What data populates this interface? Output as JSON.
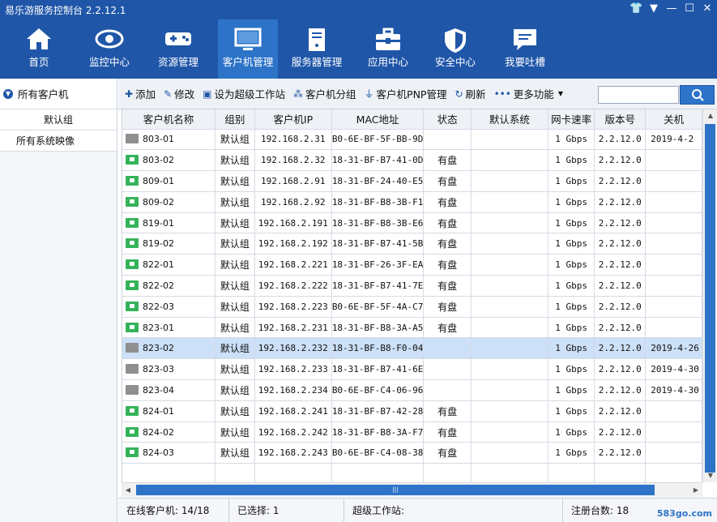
{
  "app": {
    "title": "易乐游服务控制台 2.2.12.1"
  },
  "nav": [
    {
      "id": "home",
      "label": "首页",
      "icon": "home-icon"
    },
    {
      "id": "monitor",
      "label": "监控中心",
      "icon": "eye-icon"
    },
    {
      "id": "resource",
      "label": "资源管理",
      "icon": "gamepad-icon"
    },
    {
      "id": "client",
      "label": "客户机管理",
      "icon": "monitor-icon",
      "active": true
    },
    {
      "id": "server",
      "label": "服务器管理",
      "icon": "server-icon"
    },
    {
      "id": "apps",
      "label": "应用中心",
      "icon": "toolbox-icon"
    },
    {
      "id": "security",
      "label": "安全中心",
      "icon": "shield-icon"
    },
    {
      "id": "feedback",
      "label": "我要吐槽",
      "icon": "message-icon"
    }
  ],
  "left_panel": {
    "header": "所有客户机",
    "items": [
      "默认组",
      "所有系统映像"
    ]
  },
  "toolbar": {
    "add": "添加",
    "edit": "修改",
    "super_ws": "设为超级工作站",
    "group": "客户机分组",
    "pnp": "客户机PNP管理",
    "refresh": "刷新",
    "more": "更多功能"
  },
  "table": {
    "columns": [
      "客户机名称",
      "组别",
      "客户机IP",
      "MAC地址",
      "状态",
      "默认系统",
      "网卡速率",
      "版本号",
      "关机"
    ],
    "rows": [
      {
        "name": "803-01",
        "online": false,
        "group": "默认组",
        "ip": "192.168.2.31",
        "mac": "B0-6E-BF-5F-BB-9D",
        "status": "",
        "sys": "",
        "speed": "1 Gbps",
        "ver": "2.2.12.0",
        "time": "2019-4-2"
      },
      {
        "name": "803-02",
        "online": true,
        "group": "默认组",
        "ip": "192.168.2.32",
        "mac": "18-31-BF-B7-41-0D",
        "status": "有盘",
        "sys": "",
        "speed": "1 Gbps",
        "ver": "2.2.12.0",
        "time": ""
      },
      {
        "name": "809-01",
        "online": true,
        "group": "默认组",
        "ip": "192.168.2.91",
        "mac": "18-31-BF-24-40-E5",
        "status": "有盘",
        "sys": "",
        "speed": "1 Gbps",
        "ver": "2.2.12.0",
        "time": ""
      },
      {
        "name": "809-02",
        "online": true,
        "group": "默认组",
        "ip": "192.168.2.92",
        "mac": "18-31-BF-B8-3B-F1",
        "status": "有盘",
        "sys": "",
        "speed": "1 Gbps",
        "ver": "2.2.12.0",
        "time": ""
      },
      {
        "name": "819-01",
        "online": true,
        "group": "默认组",
        "ip": "192.168.2.191",
        "mac": "18-31-BF-B8-3B-E6",
        "status": "有盘",
        "sys": "",
        "speed": "1 Gbps",
        "ver": "2.2.12.0",
        "time": ""
      },
      {
        "name": "819-02",
        "online": true,
        "group": "默认组",
        "ip": "192.168.2.192",
        "mac": "18-31-BF-B7-41-5B",
        "status": "有盘",
        "sys": "",
        "speed": "1 Gbps",
        "ver": "2.2.12.0",
        "time": ""
      },
      {
        "name": "822-01",
        "online": true,
        "group": "默认组",
        "ip": "192.168.2.221",
        "mac": "18-31-BF-26-3F-EA",
        "status": "有盘",
        "sys": "",
        "speed": "1 Gbps",
        "ver": "2.2.12.0",
        "time": ""
      },
      {
        "name": "822-02",
        "online": true,
        "group": "默认组",
        "ip": "192.168.2.222",
        "mac": "18-31-BF-B7-41-7E",
        "status": "有盘",
        "sys": "",
        "speed": "1 Gbps",
        "ver": "2.2.12.0",
        "time": ""
      },
      {
        "name": "822-03",
        "online": true,
        "group": "默认组",
        "ip": "192.168.2.223",
        "mac": "B0-6E-BF-5F-4A-C7",
        "status": "有盘",
        "sys": "",
        "speed": "1 Gbps",
        "ver": "2.2.12.0",
        "time": ""
      },
      {
        "name": "823-01",
        "online": true,
        "group": "默认组",
        "ip": "192.168.2.231",
        "mac": "18-31-BF-B8-3A-A5",
        "status": "有盘",
        "sys": "",
        "speed": "1 Gbps",
        "ver": "2.2.12.0",
        "time": ""
      },
      {
        "name": "823-02",
        "online": false,
        "group": "默认组",
        "ip": "192.168.2.232",
        "mac": "18-31-BF-B8-F0-04",
        "status": "",
        "sys": "",
        "speed": "1 Gbps",
        "ver": "2.2.12.0",
        "time": "2019-4-26",
        "selected": true
      },
      {
        "name": "823-03",
        "online": false,
        "group": "默认组",
        "ip": "192.168.2.233",
        "mac": "18-31-BF-B7-41-6E",
        "status": "",
        "sys": "",
        "speed": "1 Gbps",
        "ver": "2.2.12.0",
        "time": "2019-4-30"
      },
      {
        "name": "823-04",
        "online": false,
        "group": "默认组",
        "ip": "192.168.2.234",
        "mac": "B0-6E-BF-C4-06-96",
        "status": "",
        "sys": "",
        "speed": "1 Gbps",
        "ver": "2.2.12.0",
        "time": "2019-4-30"
      },
      {
        "name": "824-01",
        "online": true,
        "group": "默认组",
        "ip": "192.168.2.241",
        "mac": "18-31-BF-B7-42-28",
        "status": "有盘",
        "sys": "",
        "speed": "1 Gbps",
        "ver": "2.2.12.0",
        "time": ""
      },
      {
        "name": "824-02",
        "online": true,
        "group": "默认组",
        "ip": "192.168.2.242",
        "mac": "18-31-BF-B8-3A-F7",
        "status": "有盘",
        "sys": "",
        "speed": "1 Gbps",
        "ver": "2.2.12.0",
        "time": ""
      },
      {
        "name": "824-03",
        "online": true,
        "group": "默认组",
        "ip": "192.168.2.243",
        "mac": "B0-6E-BF-C4-08-38",
        "status": "有盘",
        "sys": "",
        "speed": "1 Gbps",
        "ver": "2.2.12.0",
        "time": ""
      }
    ]
  },
  "status_bar": {
    "online": "在线客户机: 14/18",
    "selected": "已选择: 1",
    "super_ws": "超级工作站:",
    "registered": "注册台数: 18"
  },
  "watermark": "583go.com",
  "colors": {
    "primary": "#1f56a8",
    "active_nav": "#2d74c8",
    "online": "#35b35a",
    "offline": "#8f8f8f",
    "selected_row": "#cce0f7"
  }
}
